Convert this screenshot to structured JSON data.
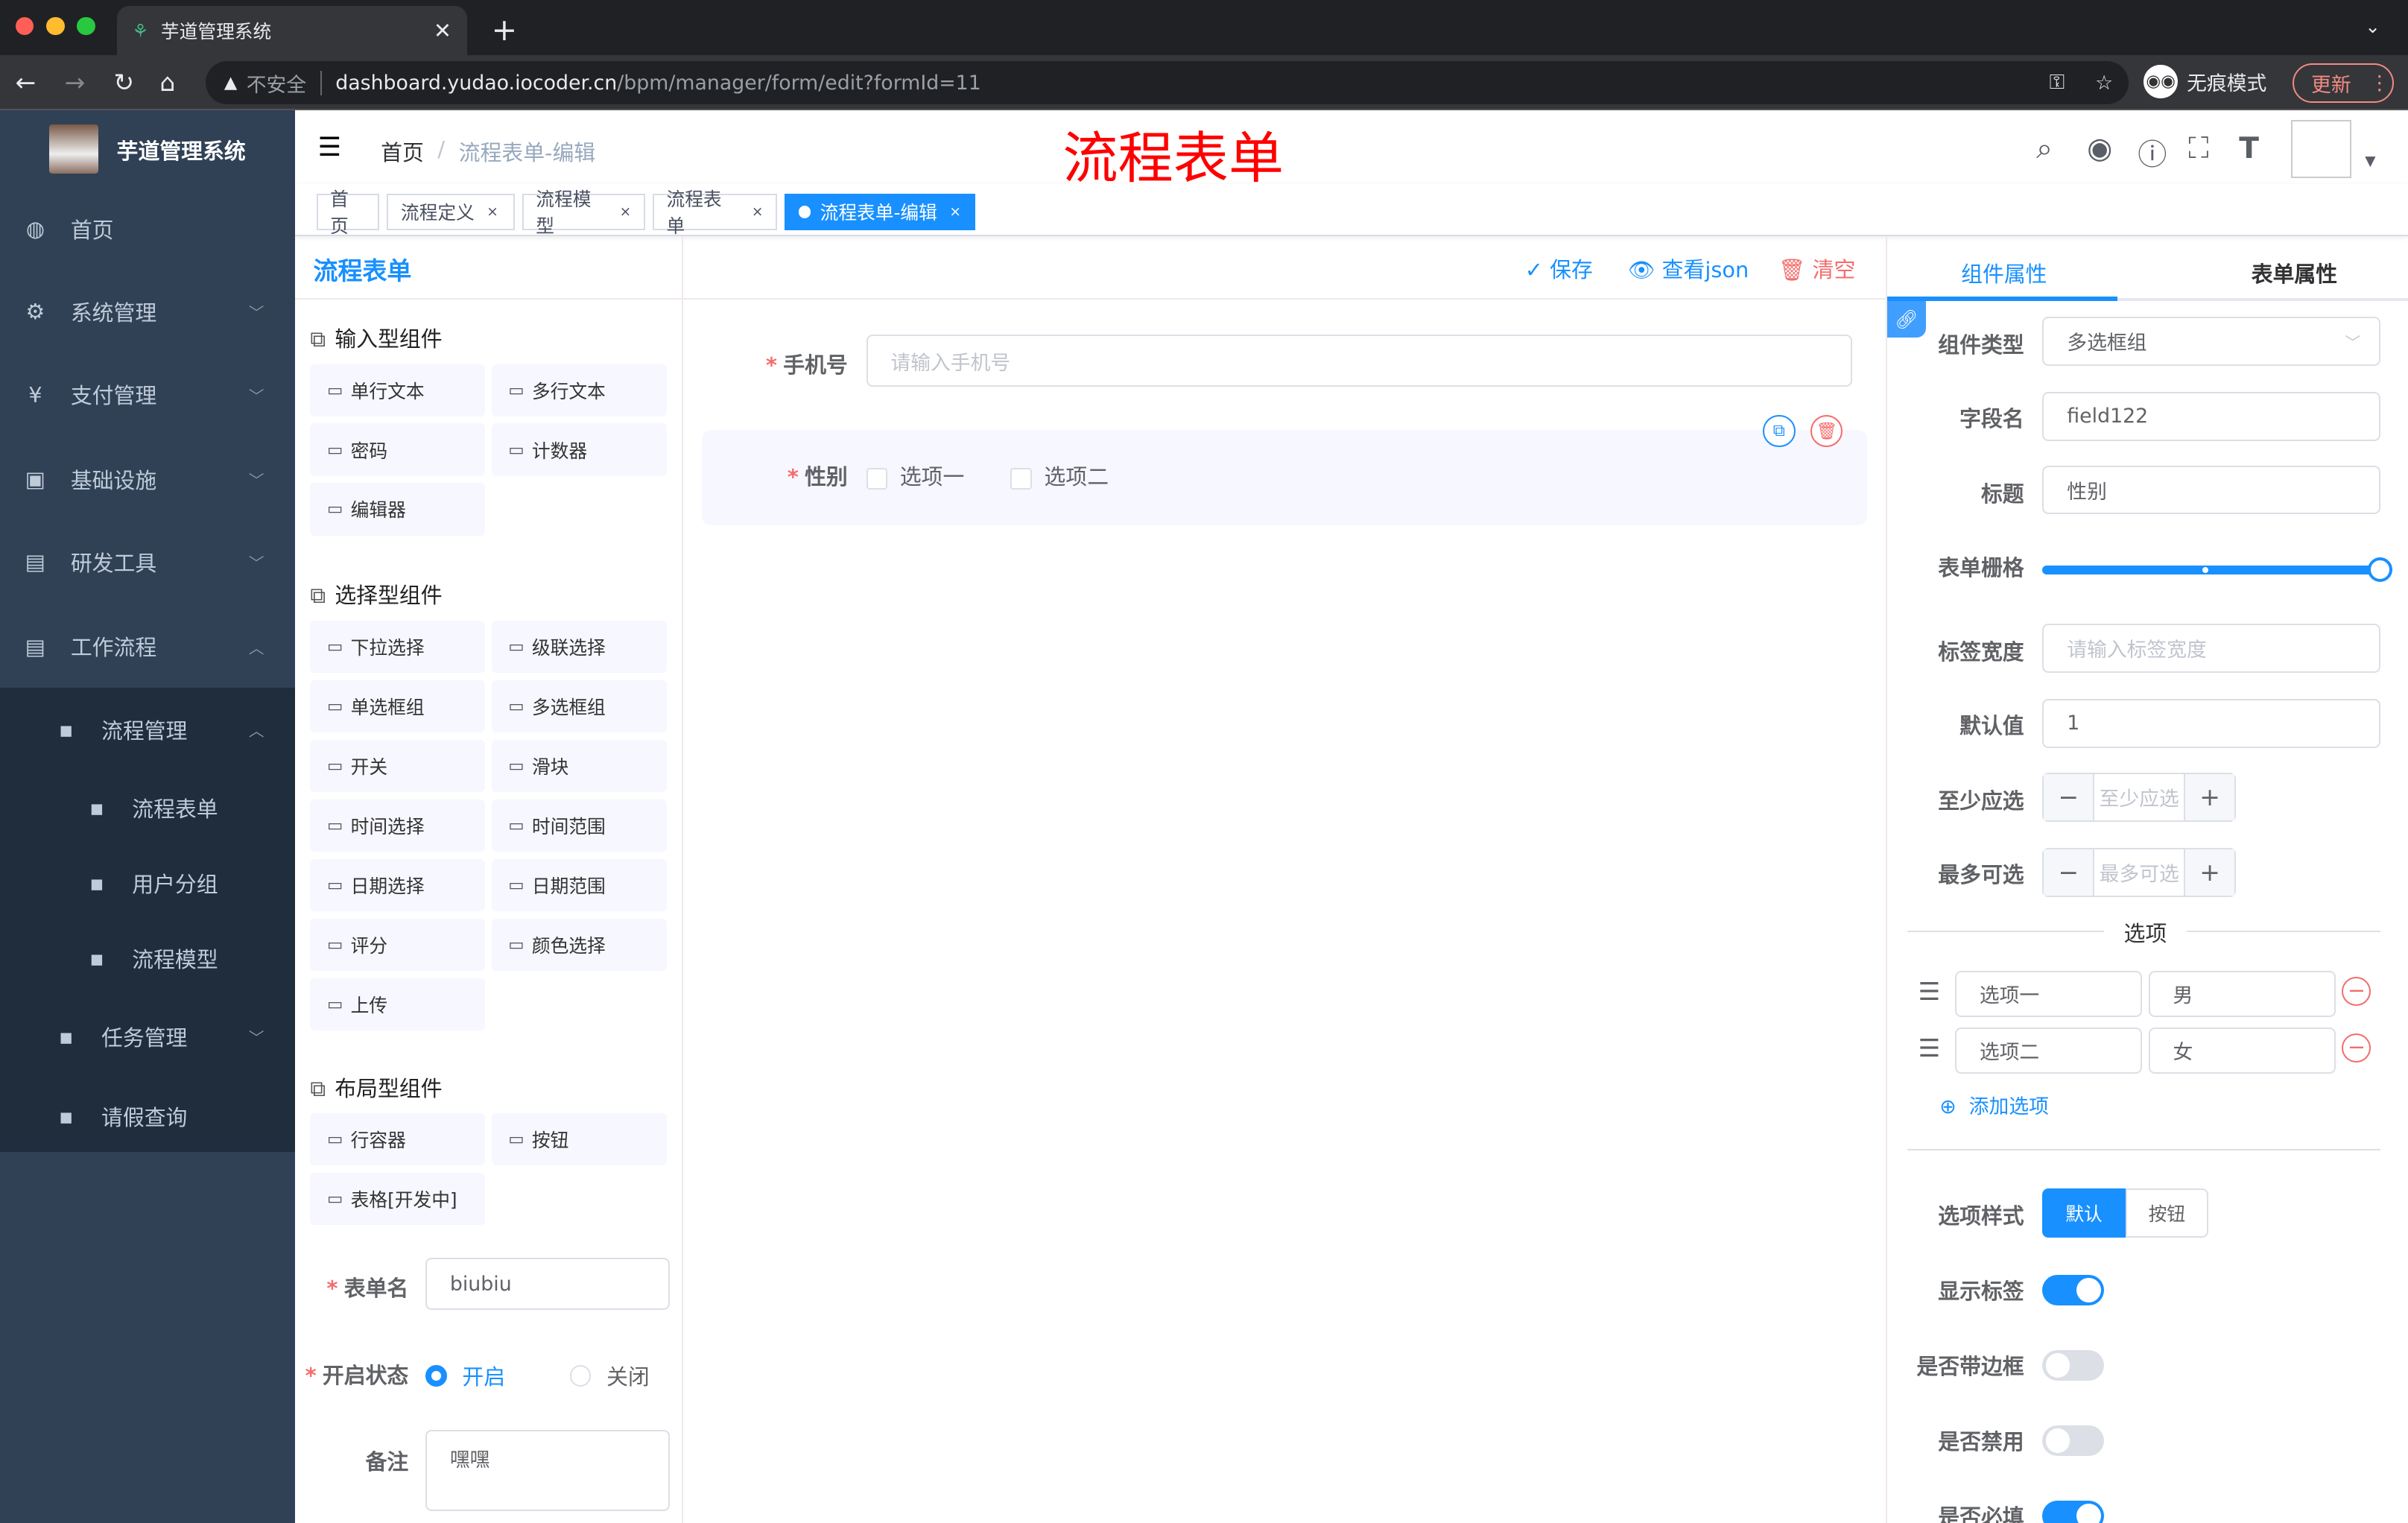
{
  "browser": {
    "tab_title": "芋道管理系统",
    "insecure_label": "不安全",
    "url_host": "dashboard.yudao.iocoder.cn",
    "url_path": "/bpm/manager/form/edit?formId=11",
    "incognito_label": "无痕模式",
    "update_label": "更新"
  },
  "sidebar": {
    "app_name": "芋道管理系统",
    "items": [
      {
        "label": "首页",
        "icon": "dashboard-icon"
      },
      {
        "label": "系统管理",
        "icon": "gear-icon",
        "chevron": "down"
      },
      {
        "label": "支付管理",
        "icon": "yen-icon",
        "chevron": "down"
      },
      {
        "label": "基础设施",
        "icon": "monitor-icon",
        "chevron": "down"
      },
      {
        "label": "研发工具",
        "icon": "toolbox-icon",
        "chevron": "down"
      },
      {
        "label": "工作流程",
        "icon": "toolbox-icon",
        "chevron": "up"
      }
    ],
    "sub_group": {
      "label": "流程管理",
      "chevron": "up"
    },
    "sub_items": [
      {
        "label": "流程表单"
      },
      {
        "label": "用户分组"
      },
      {
        "label": "流程模型"
      }
    ],
    "after": [
      {
        "label": "任务管理",
        "chevron": "down"
      },
      {
        "label": "请假查询"
      }
    ]
  },
  "navbar": {
    "breadcrumb": [
      "首页",
      "流程表单-编辑"
    ],
    "overlay_title": "流程表单"
  },
  "tags": [
    {
      "label": "首页"
    },
    {
      "label": "流程定义"
    },
    {
      "label": "流程模型"
    },
    {
      "label": "流程表单"
    },
    {
      "label": "流程表单-编辑",
      "active": true
    }
  ],
  "left": {
    "groups": [
      {
        "title": "输入型组件",
        "items": [
          "单行文本",
          "多行文本",
          "密码",
          "计数器",
          "编辑器"
        ]
      },
      {
        "title": "选择型组件",
        "items": [
          "下拉选择",
          "级联选择",
          "单选框组",
          "多选框组",
          "开关",
          "滑块",
          "时间选择",
          "时间范围",
          "日期选择",
          "日期范围",
          "评分",
          "颜色选择",
          "上传"
        ]
      },
      {
        "title": "布局型组件",
        "items": [
          "行容器",
          "按钮",
          "表格[开发中]"
        ]
      }
    ],
    "form_name_label": "表单名",
    "form_name_value": "biubiu",
    "status_label": "开启状态",
    "status_options": [
      "开启",
      "关闭"
    ],
    "status_selected": "开启",
    "remark_label": "备注",
    "remark_value": "嘿嘿"
  },
  "center": {
    "title": "流程表单",
    "save": "保存",
    "view_json": "查看json",
    "clear": "清空",
    "phone_label": "手机号",
    "phone_placeholder": "请输入手机号",
    "gender_label": "性别",
    "gender_options": [
      "选项一",
      "选项二"
    ]
  },
  "right": {
    "tabs": [
      "组件属性",
      "表单属性"
    ],
    "active_tab": "组件属性",
    "type_label": "组件类型",
    "type_value": "多选框组",
    "field_label": "字段名",
    "field_value": "field122",
    "title_label": "标题",
    "title_value": "性别",
    "grid_label": "表单栅格",
    "grid_value": 24,
    "grid_max": 24,
    "label_width_label": "标签宽度",
    "label_width_placeholder": "请输入标签宽度",
    "default_label": "默认值",
    "default_value": "1",
    "min_label": "至少应选",
    "min_placeholder": "至少应选",
    "max_label": "最多可选",
    "max_placeholder": "最多可选",
    "options_title": "选项",
    "options": [
      {
        "label": "选项一",
        "value": "男"
      },
      {
        "label": "选项二",
        "value": "女"
      }
    ],
    "add_option": "添加选项",
    "style_label": "选项样式",
    "style_options": [
      "默认",
      "按钮"
    ],
    "style_selected": "默认",
    "toggles": [
      {
        "label": "显示标签",
        "on": true
      },
      {
        "label": "是否带边框",
        "on": false
      },
      {
        "label": "是否禁用",
        "on": false
      },
      {
        "label": "是否必填",
        "on": true
      }
    ]
  },
  "colors": {
    "primary": "#1890ff",
    "sidebar": "#304156",
    "danger": "#f56c6c",
    "title_red": "#ff0000"
  }
}
